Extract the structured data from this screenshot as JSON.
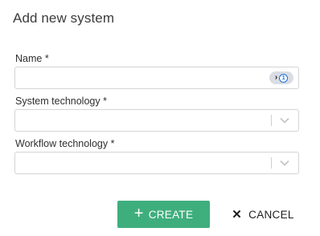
{
  "dialog": {
    "title": "Add new system"
  },
  "fields": {
    "name": {
      "label": "Name *",
      "value": "",
      "placeholder": ""
    },
    "system_technology": {
      "label": "System technology *",
      "value": ""
    },
    "workflow_technology": {
      "label": "Workflow technology *",
      "value": ""
    }
  },
  "icons": {
    "password_manager": "1password-icon",
    "dropdown": "chevron-down-icon",
    "create": "plus-icon",
    "cancel": "close-icon"
  },
  "actions": {
    "create_label": "CREATE",
    "cancel_label": "CANCEL"
  },
  "colors": {
    "primary": "#3fae7d",
    "password_accent": "#1a6fd6"
  }
}
